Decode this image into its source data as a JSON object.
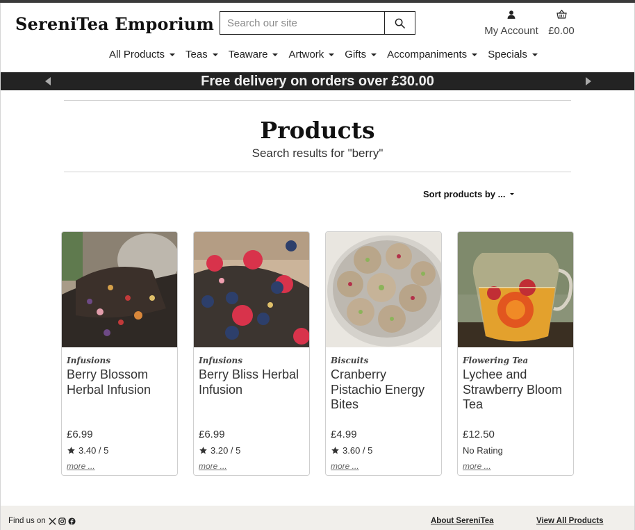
{
  "header": {
    "logo": "SereniTea Emporium",
    "search_placeholder": "Search our site",
    "account_label": "My Account",
    "basket_total": "£0.00"
  },
  "nav": {
    "items": [
      "All Products",
      "Teas",
      "Teaware",
      "Artwork",
      "Gifts",
      "Accompaniments",
      "Specials"
    ]
  },
  "banner": {
    "text": "Free delivery on orders over £30.00"
  },
  "main": {
    "title": "Products",
    "subtitle": "Search results for \"berry\"",
    "sort_label": "Sort products by ..."
  },
  "products": [
    {
      "category": "Infusions",
      "name": "Berry Blossom Herbal Infusion",
      "price": "£6.99",
      "rating": "3.40 / 5",
      "more": "more ..."
    },
    {
      "category": "Infusions",
      "name": "Berry Bliss Herbal Infusion",
      "price": "£6.99",
      "rating": "3.20 / 5",
      "more": "more ..."
    },
    {
      "category": "Biscuits",
      "name": "Cranberry Pistachio Energy Bites",
      "price": "£4.99",
      "rating": "3.60 / 5",
      "more": "more ..."
    },
    {
      "category": "Flowering Tea",
      "name": "Lychee and Strawberry Bloom Tea",
      "price": "£12.50",
      "rating": "No Rating",
      "more": "more ..."
    }
  ],
  "footer": {
    "find_us": "Find us on",
    "about": "About SereniTea",
    "view_all": "View All Products"
  },
  "colors": {
    "banner_bg": "#232323",
    "footer_bg": "#f1efeb",
    "top_bar": "#3a3a3a"
  }
}
